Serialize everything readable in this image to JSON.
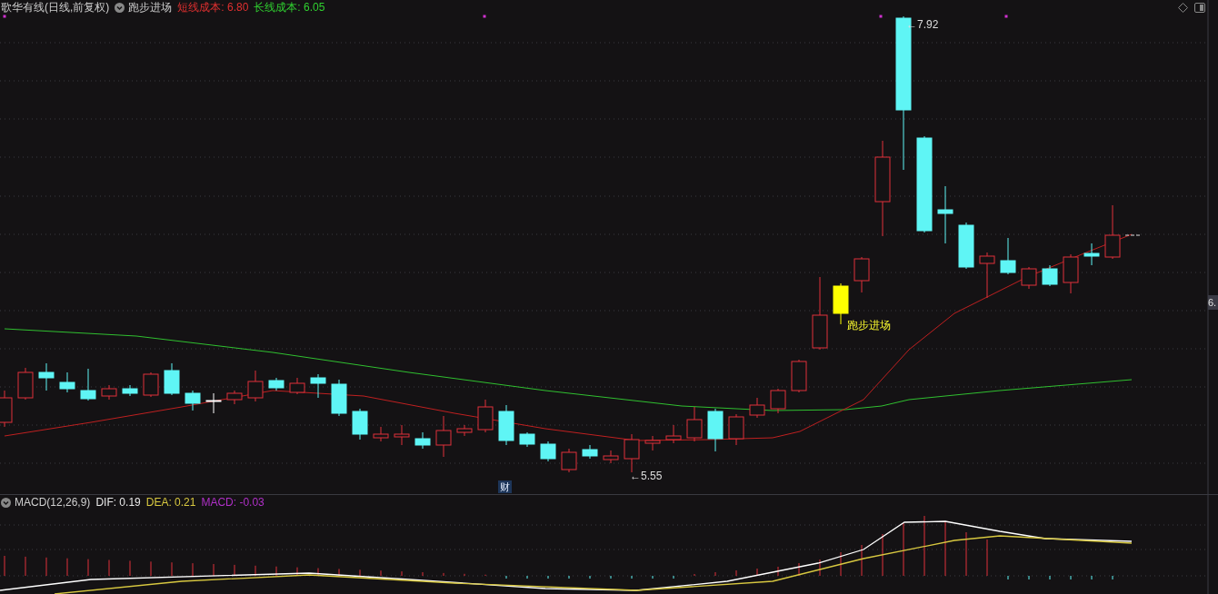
{
  "header": {
    "title": "歌华有线(日线,前复权)",
    "indicator": "跑步进场",
    "short_cost": "短线成本: 6.80",
    "long_cost": "长线成本: 6.05"
  },
  "price_chart": {
    "high_label": "←7.92",
    "low_label": "←5.55",
    "signal_label": "跑步进场",
    "event_badge": "财",
    "axis_label": "6."
  },
  "macd": {
    "title": "MACD(12,26,9)",
    "dif": "DIF: 0.19",
    "dea": "DEA: 0.21",
    "macd": "MACD: -0.03"
  }
}
